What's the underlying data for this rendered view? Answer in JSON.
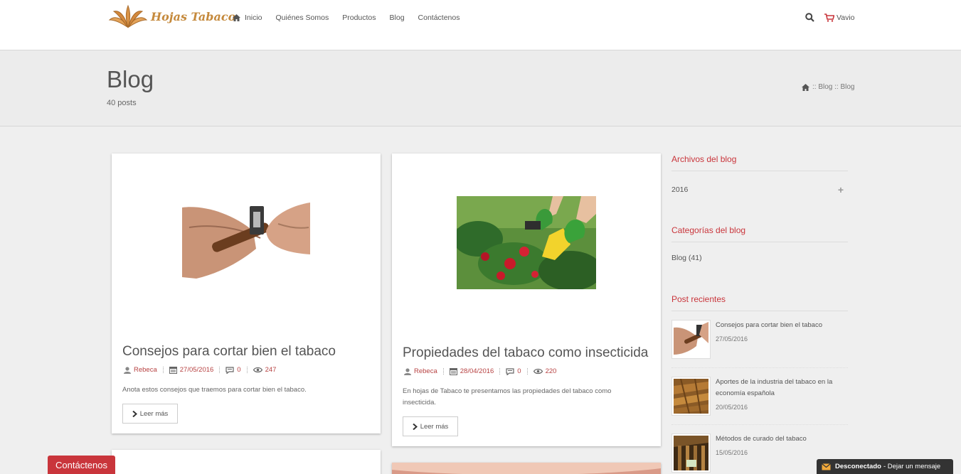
{
  "header": {
    "logo_text": "Hojas Tabaco",
    "nav": [
      {
        "label": "Inicio",
        "icon": "home-icon"
      },
      {
        "label": "Quiénes Somos"
      },
      {
        "label": "Productos"
      },
      {
        "label": "Blog"
      },
      {
        "label": "Contáctenos"
      }
    ],
    "cart_label": "Vavio"
  },
  "banner": {
    "title": "Blog",
    "posts_count": "40 posts",
    "breadcrumb": ":: Blog :: Blog"
  },
  "posts": [
    {
      "title": "Consejos para cortar bien el tabaco",
      "author": "Rebeca",
      "date": "27/05/2016",
      "comments": "0",
      "views": "247",
      "excerpt": "Anota estos consejos que traemos para cortar bien el tabaco.",
      "button": "Leer más"
    },
    {
      "title": "Propiedades del tabaco como insecticida",
      "author": "Rebeca",
      "date": "28/04/2016",
      "comments": "0",
      "views": "220",
      "excerpt": "En hojas de Tabaco te presentamos las propiedades del tabaco como insecticida.",
      "button": "Leer más"
    }
  ],
  "sidebar": {
    "archives_title": "Archivos del blog",
    "archive_year": "2016",
    "categories_title": "Categorías del blog",
    "category": "Blog (41)",
    "recent_title": "Post recientes",
    "recent": [
      {
        "title": "Consejos para cortar bien el tabaco",
        "date": "27/05/2016"
      },
      {
        "title": "Aportes de la industria del tabaco en la economía española",
        "date": "20/05/2016"
      },
      {
        "title": "Métodos de curado del tabaco",
        "date": "15/05/2016"
      }
    ]
  },
  "footer": {
    "contact_tab": "Contáctenos",
    "chat_status": "Desconectado",
    "chat_action": "- Dejar un mensaje"
  },
  "colors": {
    "accent": "#c9353b",
    "meta_link": "#b74242"
  }
}
